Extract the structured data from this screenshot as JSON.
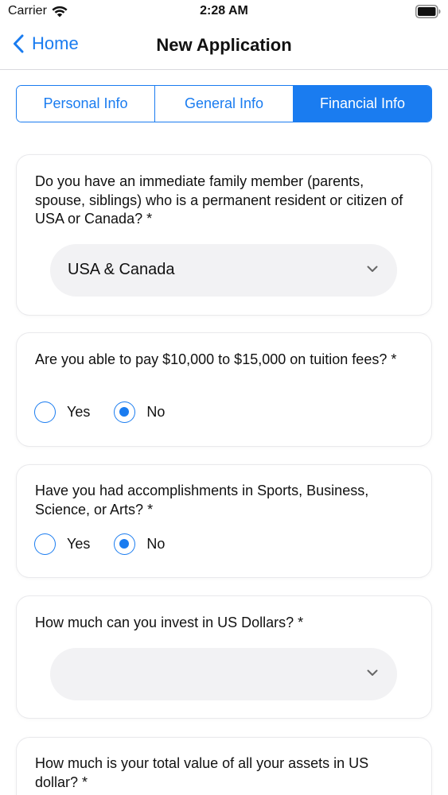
{
  "status_bar": {
    "carrier": "Carrier",
    "time": "2:28 AM",
    "wifi_icon": "wifi-icon",
    "battery_icon": "battery-icon"
  },
  "nav": {
    "back_label": "Home",
    "back_icon": "chevron-left-icon",
    "title": "New Application"
  },
  "tabs": [
    {
      "label": "Personal Info",
      "active": false
    },
    {
      "label": "General Info",
      "active": false
    },
    {
      "label": "Financial Info",
      "active": true
    }
  ],
  "questions": {
    "family": {
      "text": "Do you have an immediate family member (parents, spouse, siblings) who is a permanent resident or citizen of USA or Canada? *",
      "selected": "USA & Canada"
    },
    "tuition": {
      "text": "Are you able to pay $10,000 to $15,000 on tuition fees? *",
      "options": [
        {
          "label": "Yes",
          "checked": false
        },
        {
          "label": "No",
          "checked": true
        }
      ]
    },
    "accomplishments": {
      "text": "Have you had accomplishments in Sports, Business, Science, or Arts? *",
      "options": [
        {
          "label": "Yes",
          "checked": false
        },
        {
          "label": "No",
          "checked": true
        }
      ]
    },
    "invest": {
      "text": "How much can you invest in US Dollars? *",
      "selected": ""
    },
    "assets": {
      "text": "How much is your total value of all your assets in US dollar? *"
    }
  },
  "colors": {
    "accent": "#1a7cf0",
    "select_bg": "#f2f2f4"
  }
}
